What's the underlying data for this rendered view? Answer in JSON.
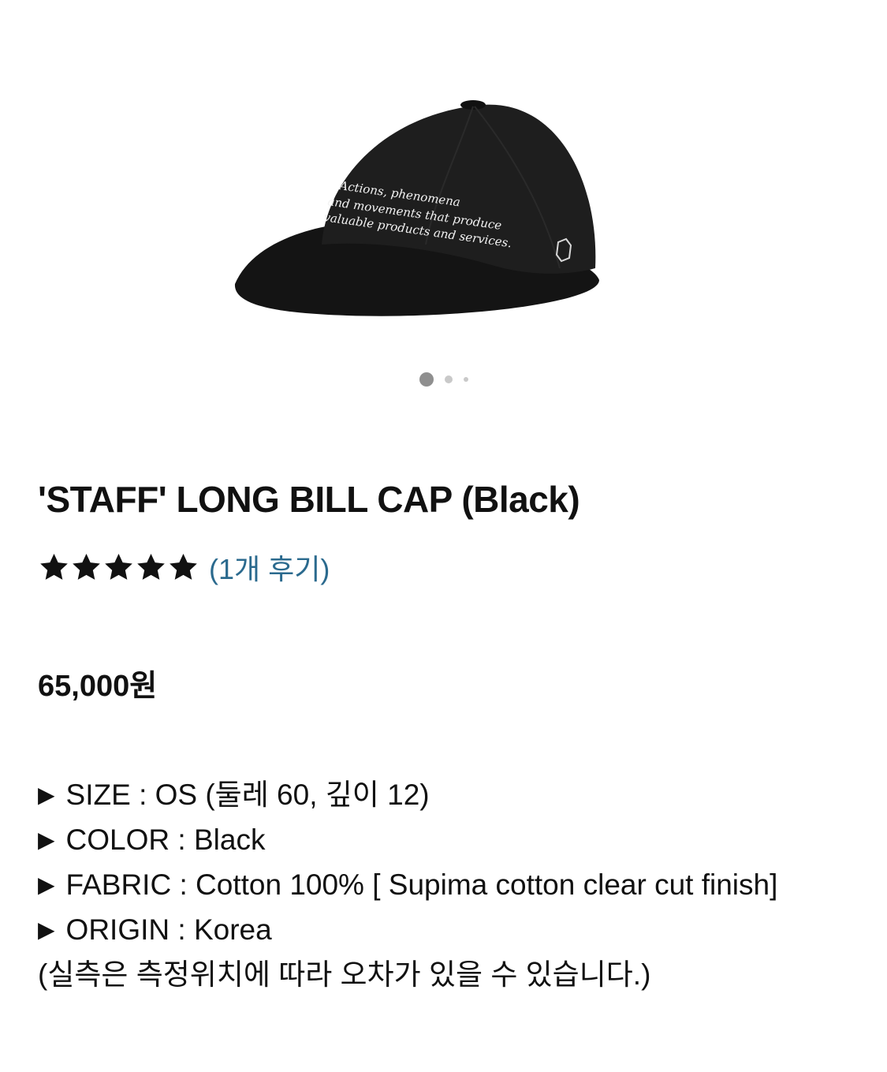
{
  "gallery": {
    "image_alt": "Black cap",
    "embroidery_lines": [
      "Actions, phenomena",
      "and movements that produce",
      "valuable products and services."
    ],
    "dots": 3,
    "active_dot": 0
  },
  "product": {
    "title": "'STAFF' LONG BILL CAP (Black)",
    "rating": 5,
    "review_text": "(1개 후기)",
    "price": "65,000원"
  },
  "specs": {
    "arrow": "▶",
    "size": "SIZE : OS (둘레 60, 깊이 12)",
    "color": "COLOR : Black",
    "fabric": "FABRIC : Cotton 100% [ Supima cotton clear cut finish]",
    "origin": "ORIGIN : Korea",
    "note": "(실측은 측정위치에 따라 오차가 있을 수 있습니다.)"
  },
  "colors": {
    "star": "#111111",
    "link": "#2b6a8e",
    "cap": "#1c1c1c"
  }
}
